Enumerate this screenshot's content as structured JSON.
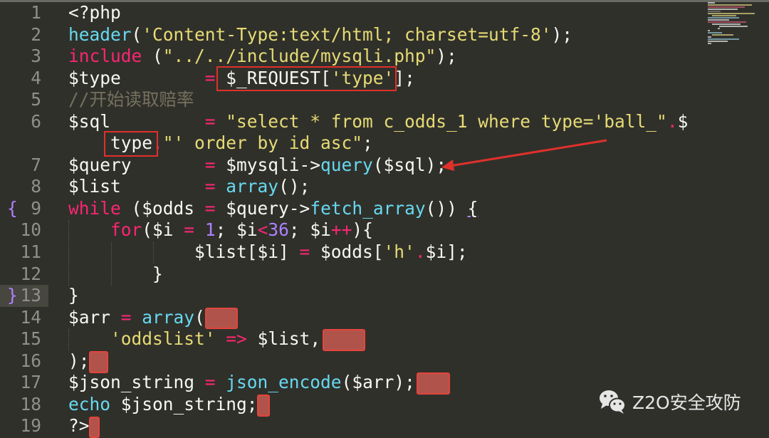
{
  "editor": {
    "theme_colors": {
      "background": "#30302b",
      "keyword": "#f92672",
      "string": "#e6db74",
      "function": "#66d9ef",
      "number": "#ae81ff",
      "comment": "#75715e",
      "text": "#f8f8f2"
    },
    "active_line": "13",
    "lines": [
      {
        "num": "1",
        "tokens": [
          [
            "<?php",
            "plain"
          ]
        ]
      },
      {
        "num": "2",
        "tokens": [
          [
            "header",
            "fn"
          ],
          [
            "(",
            "plain"
          ],
          [
            "'Content-Type:text/html; charset=utf-8'",
            "str"
          ],
          [
            ");",
            "plain"
          ]
        ]
      },
      {
        "num": "3",
        "tokens": [
          [
            "include",
            "kw"
          ],
          [
            " (",
            "plain"
          ],
          [
            "\"../../include/mysqli.php\"",
            "str"
          ],
          [
            ");",
            "plain"
          ]
        ]
      },
      {
        "num": "4",
        "tokens": [
          [
            "$type        ",
            "plain"
          ],
          [
            "=",
            "op"
          ],
          [
            " $_REQUEST[",
            "plain"
          ],
          [
            "'type'",
            "str"
          ],
          [
            "];",
            "plain"
          ]
        ]
      },
      {
        "num": "5",
        "tokens": [
          [
            "//开始读取赔率",
            "cmt"
          ]
        ]
      },
      {
        "num": "6",
        "tokens": [
          [
            "$sql         ",
            "plain"
          ],
          [
            "=",
            "op"
          ],
          [
            " ",
            "plain"
          ],
          [
            "\"select * from c_odds_1 where type='ball_\"",
            "str"
          ],
          [
            ".",
            "op"
          ],
          [
            "$",
            "plain"
          ]
        ]
      },
      {
        "num": "",
        "tokens": [
          [
            "    type",
            "plain"
          ],
          [
            ".",
            "op"
          ],
          [
            "\"' order by id asc\"",
            "str"
          ],
          [
            ";",
            "plain"
          ]
        ]
      },
      {
        "num": "7",
        "tokens": [
          [
            "$query       ",
            "plain"
          ],
          [
            "=",
            "op"
          ],
          [
            " $mysqli->",
            "plain"
          ],
          [
            "query",
            "fn"
          ],
          [
            "($sql);",
            "plain"
          ]
        ]
      },
      {
        "num": "8",
        "tokens": [
          [
            "$list        ",
            "plain"
          ],
          [
            "=",
            "op"
          ],
          [
            " ",
            "plain"
          ],
          [
            "array",
            "fn"
          ],
          [
            "();",
            "plain"
          ]
        ]
      },
      {
        "num": "9",
        "fold": "{",
        "tokens": [
          [
            "while",
            "kw"
          ],
          [
            " ($odds ",
            "plain"
          ],
          [
            "=",
            "op"
          ],
          [
            " $query->",
            "plain"
          ],
          [
            "fetch_array",
            "fn"
          ],
          [
            "()) ",
            "plain"
          ],
          [
            "{",
            "ul"
          ]
        ]
      },
      {
        "num": "10",
        "tokens": [
          [
            "    ",
            "plain"
          ],
          [
            "for",
            "kw"
          ],
          [
            "($i ",
            "plain"
          ],
          [
            "=",
            "op"
          ],
          [
            " ",
            "plain"
          ],
          [
            "1",
            "num"
          ],
          [
            "; $i",
            "plain"
          ],
          [
            "<",
            "op"
          ],
          [
            "36",
            "num"
          ],
          [
            "; $i",
            "plain"
          ],
          [
            "++",
            "op"
          ],
          [
            "){",
            "plain"
          ]
        ]
      },
      {
        "num": "11",
        "tokens": [
          [
            "            $list[$i] ",
            "plain"
          ],
          [
            "=",
            "op"
          ],
          [
            " $odds[",
            "plain"
          ],
          [
            "'h'",
            "str"
          ],
          [
            ".",
            "op"
          ],
          [
            "$i];",
            "plain"
          ]
        ]
      },
      {
        "num": "12",
        "tokens": [
          [
            "        }",
            "plain"
          ]
        ]
      },
      {
        "num": "13",
        "fold": "}",
        "tokens": [
          [
            "}",
            "plain"
          ]
        ]
      },
      {
        "num": "14",
        "tokens": [
          [
            "$arr ",
            "plain"
          ],
          [
            "=",
            "op"
          ],
          [
            " ",
            "plain"
          ],
          [
            "array",
            "fn"
          ],
          [
            "(",
            "plain"
          ]
        ]
      },
      {
        "num": "15",
        "tokens": [
          [
            "    ",
            "plain"
          ],
          [
            "'oddslist'",
            "str"
          ],
          [
            " ",
            "plain"
          ],
          [
            "=>",
            "op"
          ],
          [
            " $list,",
            "plain"
          ]
        ]
      },
      {
        "num": "16",
        "tokens": [
          [
            ");",
            "plain"
          ]
        ]
      },
      {
        "num": "17",
        "tokens": [
          [
            "$json_string ",
            "plain"
          ],
          [
            "=",
            "op"
          ],
          [
            " ",
            "plain"
          ],
          [
            "json_encode",
            "fn"
          ],
          [
            "($arr);",
            "plain"
          ]
        ]
      },
      {
        "num": "18",
        "tokens": [
          [
            "echo",
            "fn"
          ],
          [
            " $json_string;",
            "plain"
          ]
        ]
      },
      {
        "num": "19",
        "tokens": [
          [
            "?>",
            "plain"
          ]
        ]
      }
    ]
  },
  "annotations": {
    "box_color": "#e0302a",
    "redaction_color": "#b0534a"
  },
  "watermark": {
    "icon": "wechat-icon",
    "text": "Z2O安全攻防"
  }
}
